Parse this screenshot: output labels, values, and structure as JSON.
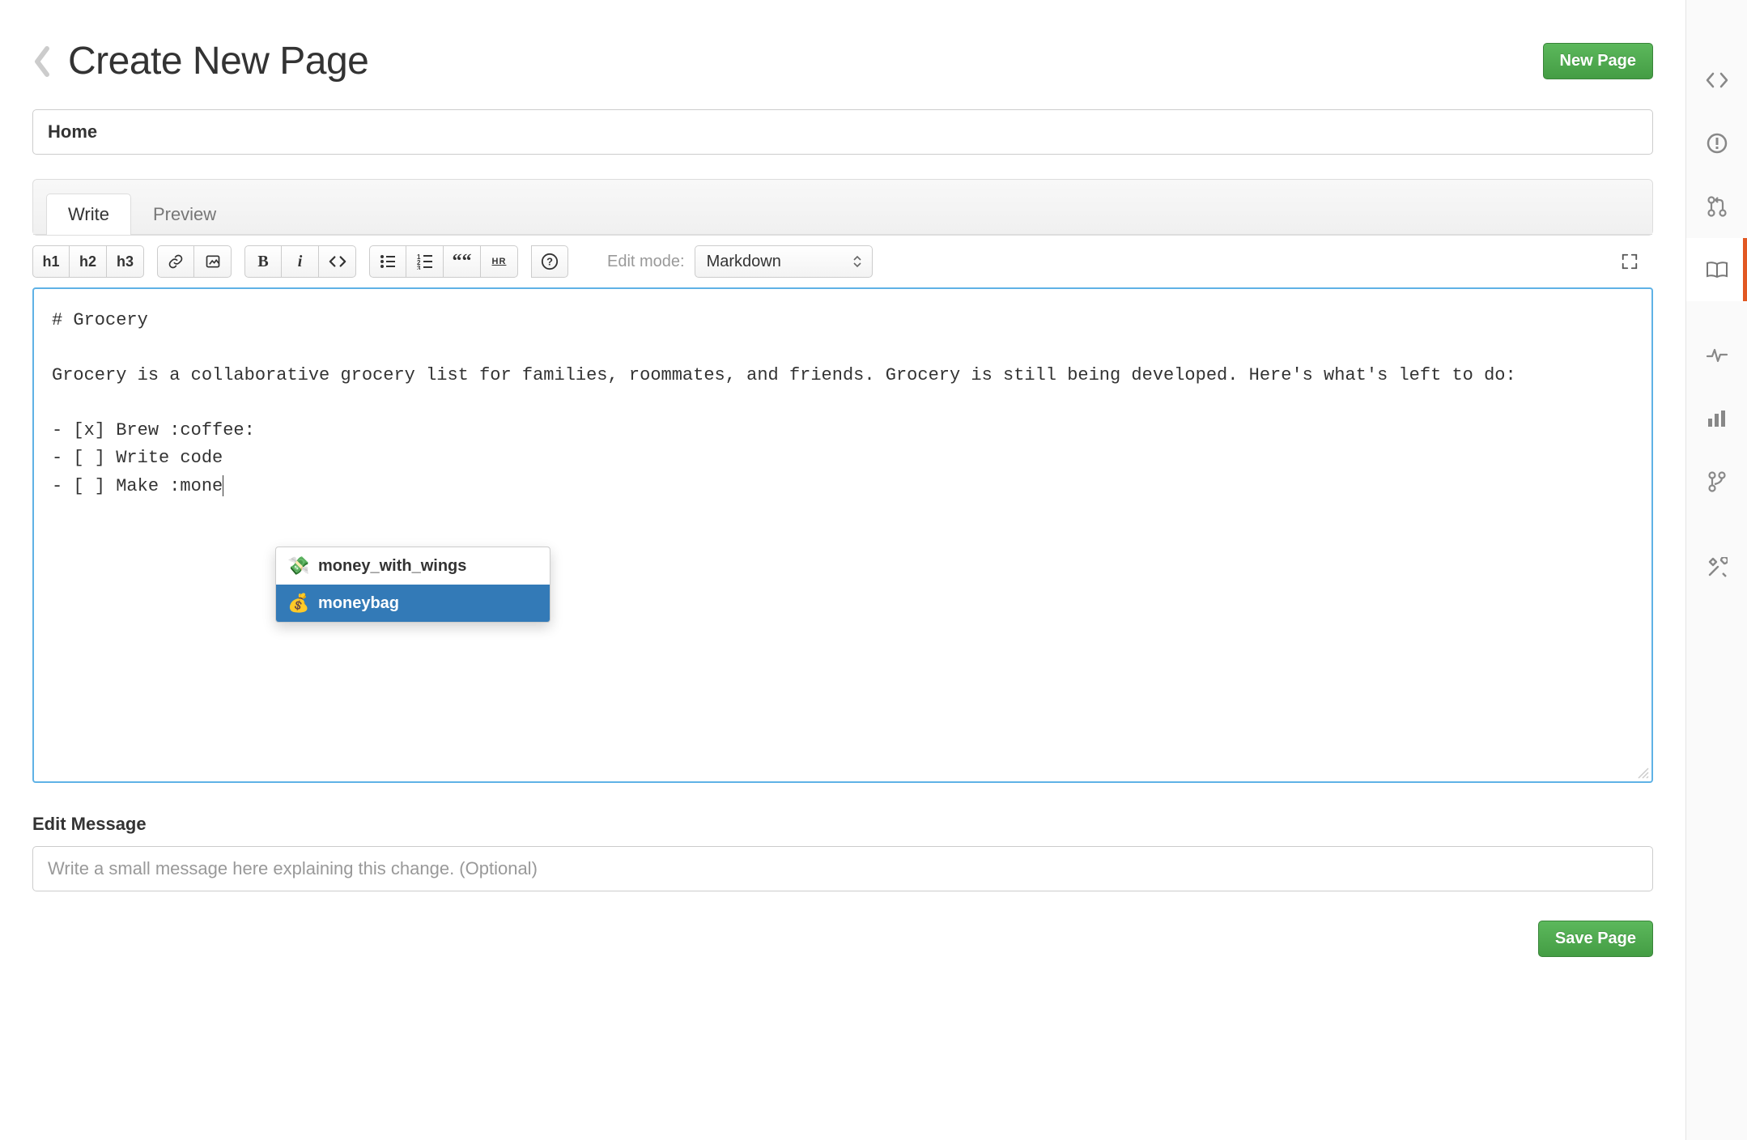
{
  "header": {
    "title": "Create New Page",
    "new_page_button": "New Page"
  },
  "title_field": {
    "value": "Home"
  },
  "tabs": {
    "write": "Write",
    "preview": "Preview",
    "active": "write"
  },
  "toolbar": {
    "h1": "h1",
    "h2": "h2",
    "h3": "h3",
    "edit_mode_label": "Edit mode:",
    "edit_mode_selected": "Markdown",
    "help_label": "?"
  },
  "editor": {
    "content": "# Grocery\n\nGrocery is a collaborative grocery list for families, roommates, and friends. Grocery is still being developed. Here's what's left to do:\n\n- [x] Brew :coffee:\n- [ ] Write code\n- [ ] Make :mone"
  },
  "autocomplete": {
    "items": [
      {
        "emoji": "💸",
        "label": "money_with_wings",
        "selected": false
      },
      {
        "emoji": "💰",
        "label": "moneybag",
        "selected": true
      }
    ]
  },
  "edit_message": {
    "label": "Edit Message",
    "placeholder": "Write a small message here explaining this change. (Optional)",
    "value": ""
  },
  "footer": {
    "save_button": "Save Page"
  },
  "rail_icons": [
    "code",
    "issues",
    "pull-requests",
    "wiki",
    "pulse",
    "graphs",
    "network",
    "settings"
  ]
}
